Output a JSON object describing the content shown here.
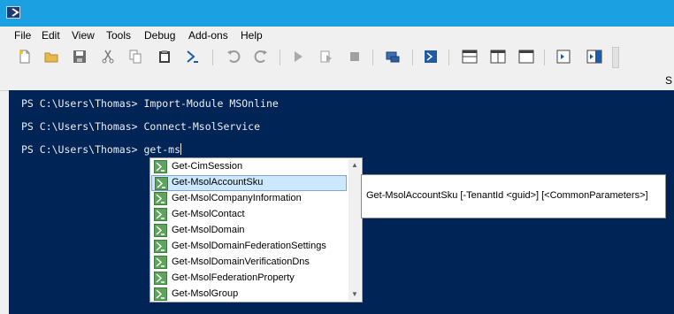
{
  "menubar": {
    "items": [
      "File",
      "Edit",
      "View",
      "Tools",
      "Debug",
      "Add-ons",
      "Help"
    ]
  },
  "toolbar": {
    "icons": [
      "new-file-icon",
      "open-folder-icon",
      "save-icon",
      "cut-icon",
      "copy-icon",
      "paste-icon",
      "powershell-icon",
      "undo-icon",
      "redo-icon",
      "run-icon",
      "run-selection-icon",
      "stop-icon",
      "remote-powershell-icon",
      "start-powershell-icon",
      "show-script-pane-top-icon",
      "show-script-pane-right-icon",
      "show-script-pane-max-icon",
      "show-command-window-icon",
      "show-command-addon-icon"
    ]
  },
  "strip": {
    "trailing_text": "S"
  },
  "console": {
    "lines": [
      "PS C:\\Users\\Thomas> Import-Module MSOnline",
      "PS C:\\Users\\Thomas> Connect-MsolService",
      "PS C:\\Users\\Thomas> get-ms"
    ]
  },
  "intellisense": {
    "items": [
      "Get-CimSession",
      "Get-MsolAccountSku",
      "Get-MsolCompanyInformation",
      "Get-MsolContact",
      "Get-MsolDomain",
      "Get-MsolDomainFederationSettings",
      "Get-MsolDomainVerificationDns",
      "Get-MsolFederationProperty",
      "Get-MsolGroup"
    ],
    "selected_index": 1,
    "tooltip": "Get-MsolAccountSku [-TenantId <guid>] [<CommonParameters>]"
  },
  "colors": {
    "titlebar": "#1ba1e2",
    "console_bg": "#012456",
    "console_text": "#eeedf0",
    "selection": "#cce8ff"
  }
}
